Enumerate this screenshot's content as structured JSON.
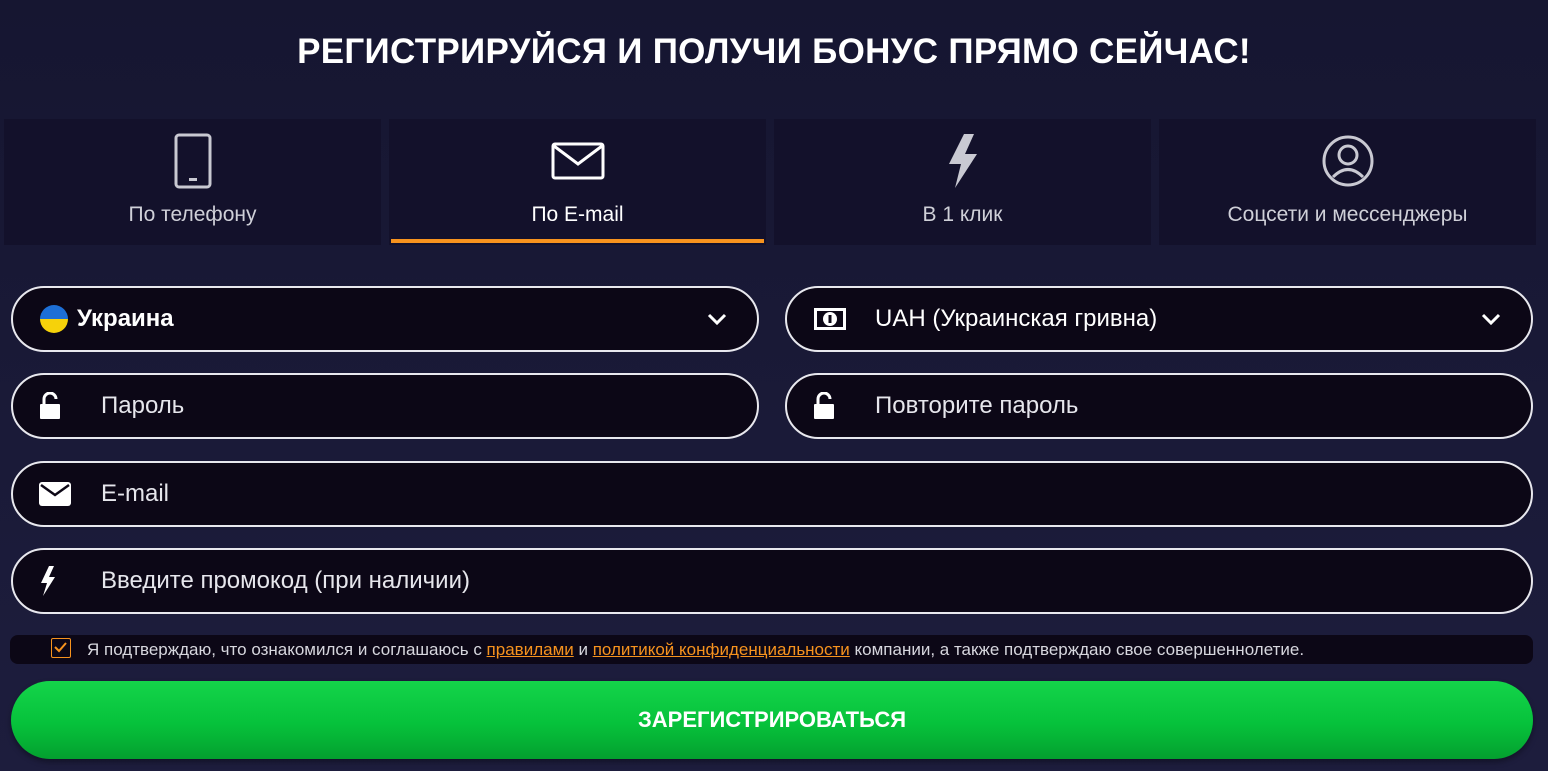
{
  "header": {
    "title": "РЕГИСТРИРУЙСЯ И ПОЛУЧИ БОНУС ПРЯМО СЕЙЧАС!"
  },
  "tabs": [
    {
      "label": "По телефону",
      "icon": "phone-icon",
      "active": false
    },
    {
      "label": "По E-mail",
      "icon": "envelope-icon",
      "active": true
    },
    {
      "label": "В 1 клик",
      "icon": "lightning-icon",
      "active": false
    },
    {
      "label": "Соцсети и мессенджеры",
      "icon": "user-circle-icon",
      "active": false
    }
  ],
  "form": {
    "country": {
      "value": "Украина",
      "icon": "ukraine-flag-icon"
    },
    "currency": {
      "value": "UAH (Украинская гривна)",
      "icon": "banknote-icon"
    },
    "password": {
      "placeholder": "Пароль",
      "icon": "unlock-icon"
    },
    "repeat_password": {
      "placeholder": "Повторите пароль",
      "icon": "unlock-icon"
    },
    "email": {
      "placeholder": "E-mail",
      "icon": "envelope-icon"
    },
    "promo": {
      "placeholder": "Введите промокод (при наличии)",
      "icon": "lightning-icon"
    }
  },
  "consent": {
    "checked": true,
    "text_before": "Я подтверждаю, что ознакомился и соглашаюсь с ",
    "rules_link": "правилами",
    "text_and": " и ",
    "privacy_link": "политикой конфиденциальности",
    "text_after": " компании, а также подтверждаю свое совершеннолетие."
  },
  "submit_label": "ЗАРЕГИСТРИРОВАТЬСЯ",
  "colors": {
    "accent": "#f7931e",
    "button": "#06c23b",
    "background": "#1a1a38",
    "panel": "#13112b"
  }
}
